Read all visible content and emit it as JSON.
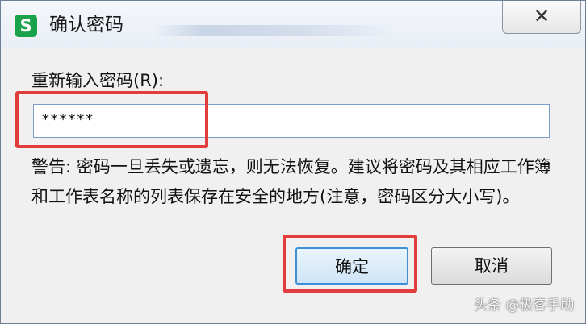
{
  "window": {
    "app_icon_letter": "S",
    "title": "确认密码",
    "close_glyph": "✕"
  },
  "form": {
    "label": "重新输入密码(R):",
    "password_value": "******",
    "warning": "警告: 密码一旦丢失或遗忘，则无法恢复。建议将密码及其相应工作簿和工作表名称的列表保存在安全的地方(注意，密码区分大小写)。"
  },
  "buttons": {
    "ok_label": "确定",
    "cancel_label": "取消"
  },
  "annotations": {
    "highlight_color": "#e23c3c"
  },
  "watermark": {
    "text": "头条 @极客手助"
  },
  "colors": {
    "app_icon_bg": "#19a24a",
    "input_border": "#7a9cc8",
    "ok_button_border": "#3c8fd8"
  }
}
